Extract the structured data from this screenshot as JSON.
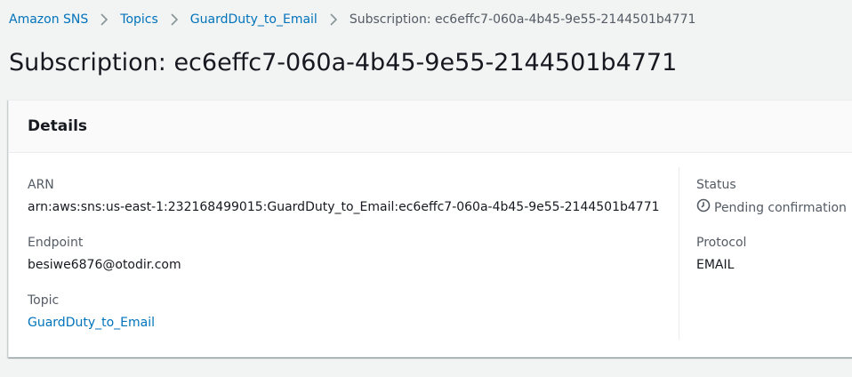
{
  "breadcrumb": {
    "items": [
      {
        "label": "Amazon SNS"
      },
      {
        "label": "Topics"
      },
      {
        "label": "GuardDuty_to_Email"
      }
    ],
    "current": "Subscription: ec6effc7-060a-4b45-9e55-2144501b4771"
  },
  "page": {
    "title": "Subscription: ec6effc7-060a-4b45-9e55-2144501b4771"
  },
  "details": {
    "heading": "Details",
    "arn": {
      "label": "ARN",
      "value": "arn:aws:sns:us-east-1:232168499015:GuardDuty_to_Email:ec6effc7-060a-4b45-9e55-2144501b4771"
    },
    "endpoint": {
      "label": "Endpoint",
      "value": "besiwe6876@otodir.com"
    },
    "topic": {
      "label": "Topic",
      "value": "GuardDuty_to_Email"
    },
    "status": {
      "label": "Status",
      "value": "Pending confirmation",
      "icon": "clock-icon"
    },
    "protocol": {
      "label": "Protocol",
      "value": "EMAIL"
    }
  },
  "colors": {
    "link": "#0073bb",
    "text": "#16191f",
    "muted": "#545b64",
    "background": "#f2f3f3"
  }
}
